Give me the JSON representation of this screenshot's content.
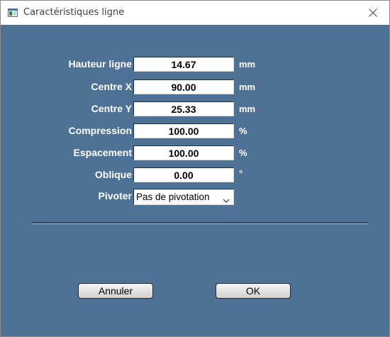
{
  "window": {
    "title": "Caractéristiques ligne"
  },
  "fields": [
    {
      "label": "Hauteur ligne",
      "value": "14.67",
      "unit": "mm"
    },
    {
      "label": "Centre X",
      "value": "90.00",
      "unit": "mm"
    },
    {
      "label": "Centre Y",
      "value": "25.33",
      "unit": "mm"
    },
    {
      "label": "Compression",
      "value": "100.00",
      "unit": "%"
    },
    {
      "label": "Espacement",
      "value": "100.00",
      "unit": "%"
    },
    {
      "label": "Oblique",
      "value": "0.00",
      "unit": "°"
    }
  ],
  "pivot": {
    "label": "Pivoter",
    "selected": "Pas de pivotation"
  },
  "buttons": {
    "cancel_label": "Annuler",
    "ok_label": "OK"
  },
  "icons": {
    "app": "window-app-icon",
    "close": "close-icon",
    "dropdown": "chevron-down-icon"
  },
  "colors": {
    "client_background": "#4e7196",
    "label_text": "#ffffff"
  }
}
